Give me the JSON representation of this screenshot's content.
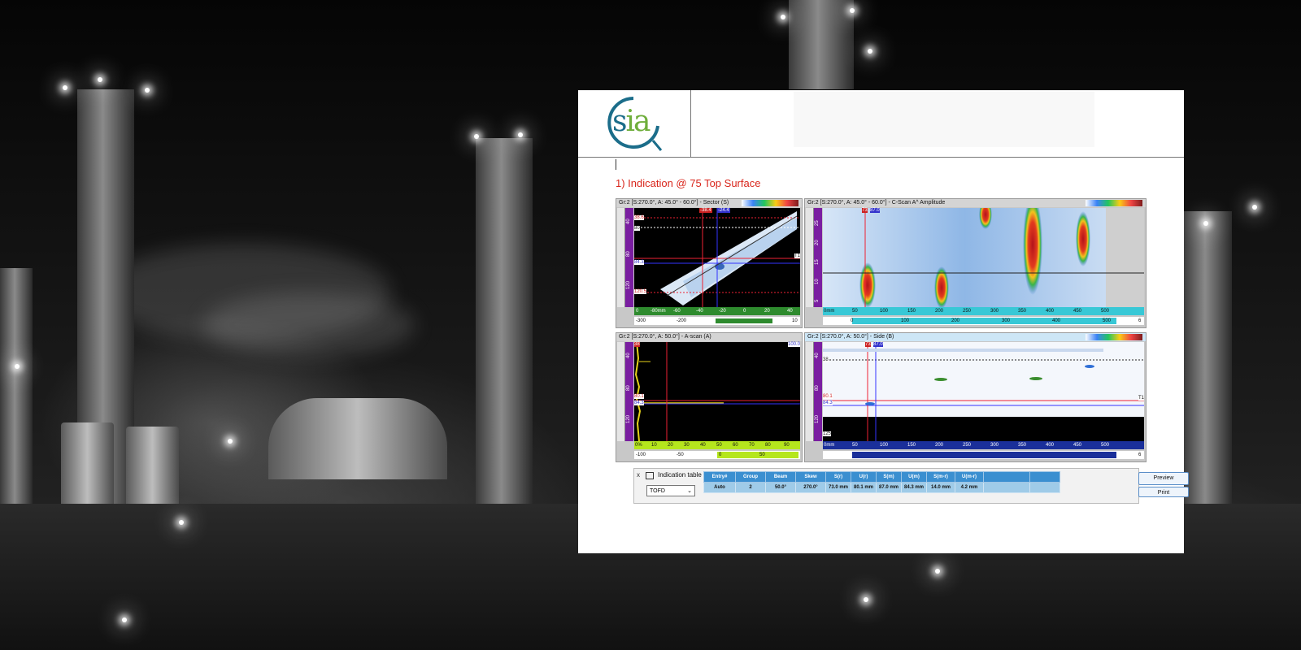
{
  "document": {
    "logo_text": "sia",
    "title": "1) Indication @ 75 Top Surface"
  },
  "panels": {
    "sector": {
      "title": "Gr:2 [S:270.0°, A: 45.0° - 60.0°] - Sector (S)",
      "cursor_labels": [
        "-38.4",
        "-24.4"
      ],
      "left_labels": [
        "38.6",
        "80",
        "84.3",
        "120.5"
      ],
      "right_marker": "T1",
      "vscale_ticks": [
        "0",
        "40",
        "80",
        "120"
      ],
      "hscale_ticks": [
        "0",
        "-80mm",
        "-60",
        "-40",
        "-20",
        "0",
        "20",
        "40"
      ],
      "bottom_ticks": [
        "-300",
        "-200",
        "10"
      ]
    },
    "cscan": {
      "title": "Gr:2 [S:270.0°, A: 45.0° - 60.0°] - C-Scan A^ Amplitude",
      "cursor_labels": [
        "73",
        "87.0"
      ],
      "vscale_ticks": [
        "25",
        "20",
        "15",
        "10",
        "5"
      ],
      "hscale_ticks": [
        "0mm",
        "50",
        "100",
        "150",
        "200",
        "250",
        "300",
        "350",
        "400",
        "450",
        "500"
      ],
      "bottom_ticks": [
        "0",
        "100",
        "200",
        "300",
        "400",
        "500",
        "6"
      ]
    },
    "ascan": {
      "title": "Gr:2 [S:270.0°, A: 50.0°] - A-scan (A)",
      "top_right_value": "100.0",
      "left_labels": [
        "38",
        "80.1",
        "84.3"
      ],
      "vscale_ticks": [
        "0",
        "40",
        "80",
        "120"
      ],
      "hscale_ticks": [
        "0%",
        "10",
        "20",
        "30",
        "40",
        "50",
        "60",
        "70",
        "80",
        "90"
      ],
      "bottom_ticks": [
        "-100",
        "-50",
        "0",
        "50"
      ]
    },
    "side": {
      "title": "Gr:2 [S:270.0°, A: 50.0°] - Side (B)",
      "cursor_labels": [
        "73",
        "87.0"
      ],
      "left_labels": [
        "38",
        "80.1",
        "84.3",
        "125"
      ],
      "right_marker": "T1",
      "vscale_ticks": [
        "0",
        "40",
        "80",
        "120"
      ],
      "hscale_ticks": [
        "0mm",
        "50",
        "100",
        "150",
        "200",
        "250",
        "300",
        "350",
        "400",
        "450",
        "500"
      ],
      "bottom_ticks": [
        "6"
      ]
    }
  },
  "indication_table": {
    "label": "Indication table",
    "close": "x",
    "mode_value": "TOFD",
    "columns": [
      "Entry#",
      "Group",
      "Beam",
      "Skew",
      "S(r)",
      "U(r)",
      "S(m)",
      "U(m)",
      "S(m-r)",
      "U(m-r)",
      "",
      ""
    ],
    "rows": [
      [
        "Auto",
        "2",
        "50.0°",
        "270.0°",
        "73.0 mm",
        "80.1 mm",
        "87.0 mm",
        "84.3 mm",
        "14.0 mm",
        "4.2 mm",
        "",
        ""
      ]
    ],
    "preview_label": "Preview",
    "print_label": "Print"
  }
}
